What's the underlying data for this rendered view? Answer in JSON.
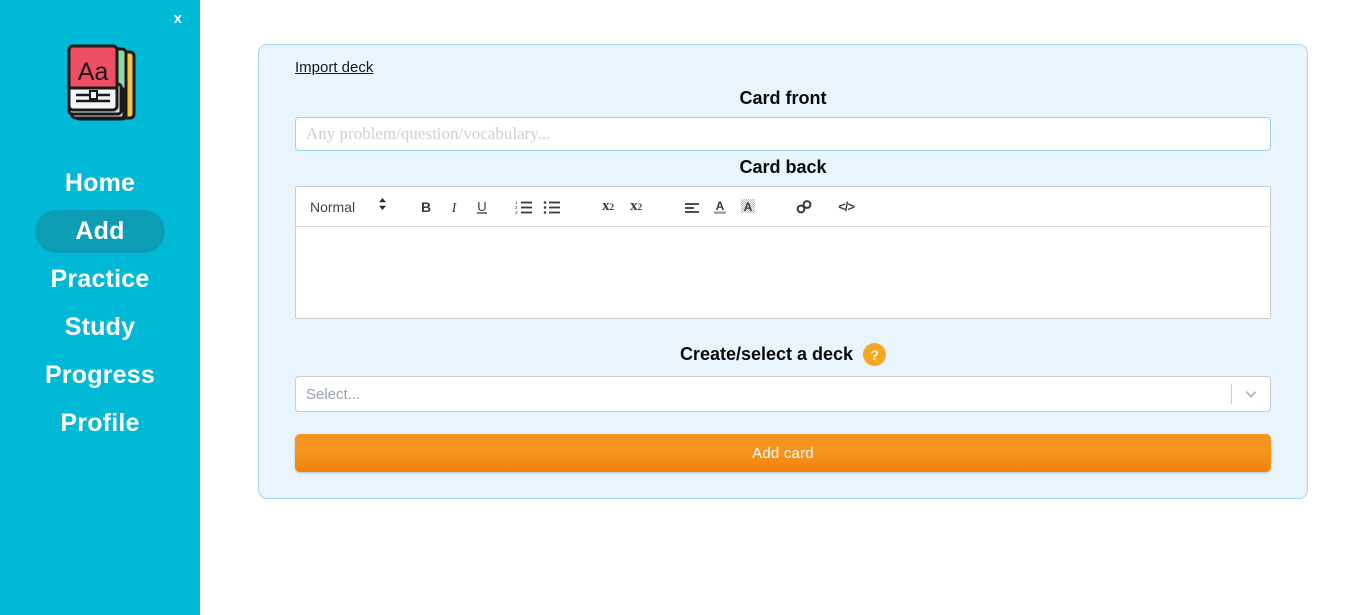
{
  "app": {
    "close_label": "x",
    "logo_name": "flashcard-stack-logo",
    "logo_letters": "Aa"
  },
  "sidebar": {
    "items": [
      {
        "label": "Home",
        "name": "sidebar-item-home",
        "active": false
      },
      {
        "label": "Add",
        "name": "sidebar-item-add",
        "active": true
      },
      {
        "label": "Practice",
        "name": "sidebar-item-practice",
        "active": false
      },
      {
        "label": "Study",
        "name": "sidebar-item-study",
        "active": false
      },
      {
        "label": "Progress",
        "name": "sidebar-item-progress",
        "active": false
      },
      {
        "label": "Profile",
        "name": "sidebar-item-profile",
        "active": false
      }
    ]
  },
  "main": {
    "import_link": "Import deck",
    "card_front": {
      "heading": "Card front",
      "placeholder": "Any problem/question/vocabulary...",
      "value": ""
    },
    "card_back": {
      "heading": "Card back",
      "value": ""
    },
    "editor_toolbar": {
      "format_label": "Normal",
      "buttons": [
        {
          "name": "bold-icon",
          "label": "B"
        },
        {
          "name": "italic-icon",
          "label": "I"
        },
        {
          "name": "underline-icon",
          "label": "U"
        },
        {
          "name": "ordered-list-icon",
          "label": ""
        },
        {
          "name": "bullet-list-icon",
          "label": ""
        },
        {
          "name": "superscript-icon",
          "label": "x2"
        },
        {
          "name": "subscript-icon",
          "label": "x2"
        },
        {
          "name": "align-icon",
          "label": ""
        },
        {
          "name": "text-color-icon",
          "label": "A"
        },
        {
          "name": "background-color-icon",
          "label": "A"
        },
        {
          "name": "link-icon",
          "label": ""
        },
        {
          "name": "code-block-icon",
          "label": "</>"
        }
      ]
    },
    "deck": {
      "heading": "Create/select a deck",
      "help_badge": "?",
      "select_placeholder": "Select...",
      "selected_value": ""
    },
    "submit_label": "Add card"
  },
  "colors": {
    "sidebar": "#00b9d7",
    "sidebar_active": "#0c9cb4",
    "panel_bg": "#eaf4fd",
    "panel_border": "#a8d5ef",
    "accent_orange": "#f79421",
    "help_badge": "#f5a623"
  }
}
